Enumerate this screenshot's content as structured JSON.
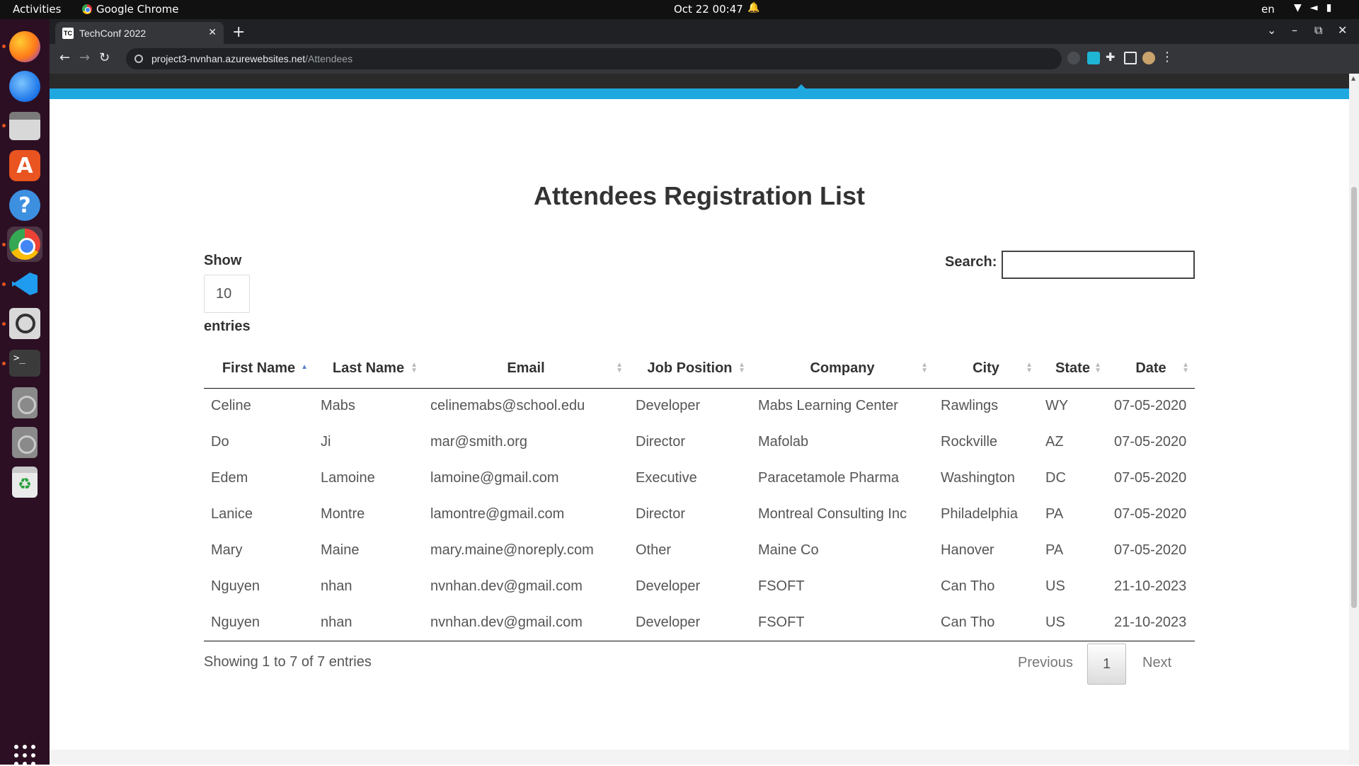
{
  "topbar": {
    "activities": "Activities",
    "app_name": "Google Chrome",
    "clock": "Oct 22  00:47",
    "lang": "en"
  },
  "dock": {
    "items": [
      "firefox-icon",
      "thunderbird-icon",
      "files-icon",
      "app-center-icon",
      "help-icon",
      "chrome-icon",
      "vscode-icon",
      "search-tool-icon",
      "terminal-icon",
      "disk-icon",
      "disk-icon",
      "trash-icon"
    ]
  },
  "browser": {
    "tab_title": "TechConf 2022",
    "tab_favicon": "TC",
    "url_host": "project3-nvnhan.azurewebsites.net",
    "url_path": "/Attendees"
  },
  "page": {
    "title": "Attendees Registration List",
    "length_label": "Show",
    "length_value": "10",
    "length_suffix": "entries",
    "search_label": "Search:",
    "search_value": "",
    "columns": [
      "First Name",
      "Last Name",
      "Email",
      "Job Position",
      "Company",
      "City",
      "State",
      "Date"
    ],
    "sorted_column": "First Name",
    "sort_direction": "ascending",
    "rows": [
      [
        "Celine",
        "Mabs",
        "celinemabs@school.edu",
        "Developer",
        "Mabs Learning Center",
        "Rawlings",
        "WY",
        "07-05-2020"
      ],
      [
        "Do",
        "Ji",
        "mar@smith.org",
        "Director",
        "Mafolab",
        "Rockville",
        "AZ",
        "07-05-2020"
      ],
      [
        "Edem",
        "Lamoine",
        "lamoine@gmail.com",
        "Executive",
        "Paracetamole Pharma",
        "Washington",
        "DC",
        "07-05-2020"
      ],
      [
        "Lanice",
        "Montre",
        "lamontre@gmail.com",
        "Director",
        "Montreal Consulting Inc",
        "Philadelphia",
        "PA",
        "07-05-2020"
      ],
      [
        "Mary",
        "Maine",
        "mary.maine@noreply.com",
        "Other",
        "Maine Co",
        "Hanover",
        "PA",
        "07-05-2020"
      ],
      [
        "Nguyen",
        "nhan",
        "nvnhan.dev@gmail.com",
        "Developer",
        "FSOFT",
        "Can Tho",
        "US",
        "21-10-2023"
      ],
      [
        "Nguyen",
        "nhan",
        "nvnhan.dev@gmail.com",
        "Developer",
        "FSOFT",
        "Can Tho",
        "US",
        "21-10-2023"
      ]
    ],
    "info": "Showing 1 to 7 of 7 entries",
    "pagination": {
      "previous": "Previous",
      "current": "1",
      "next": "Next"
    }
  },
  "colors": {
    "accent_bar": "#1fa8e0",
    "dock_bg": "#2c0f23",
    "browser_frame": "#35363a"
  }
}
